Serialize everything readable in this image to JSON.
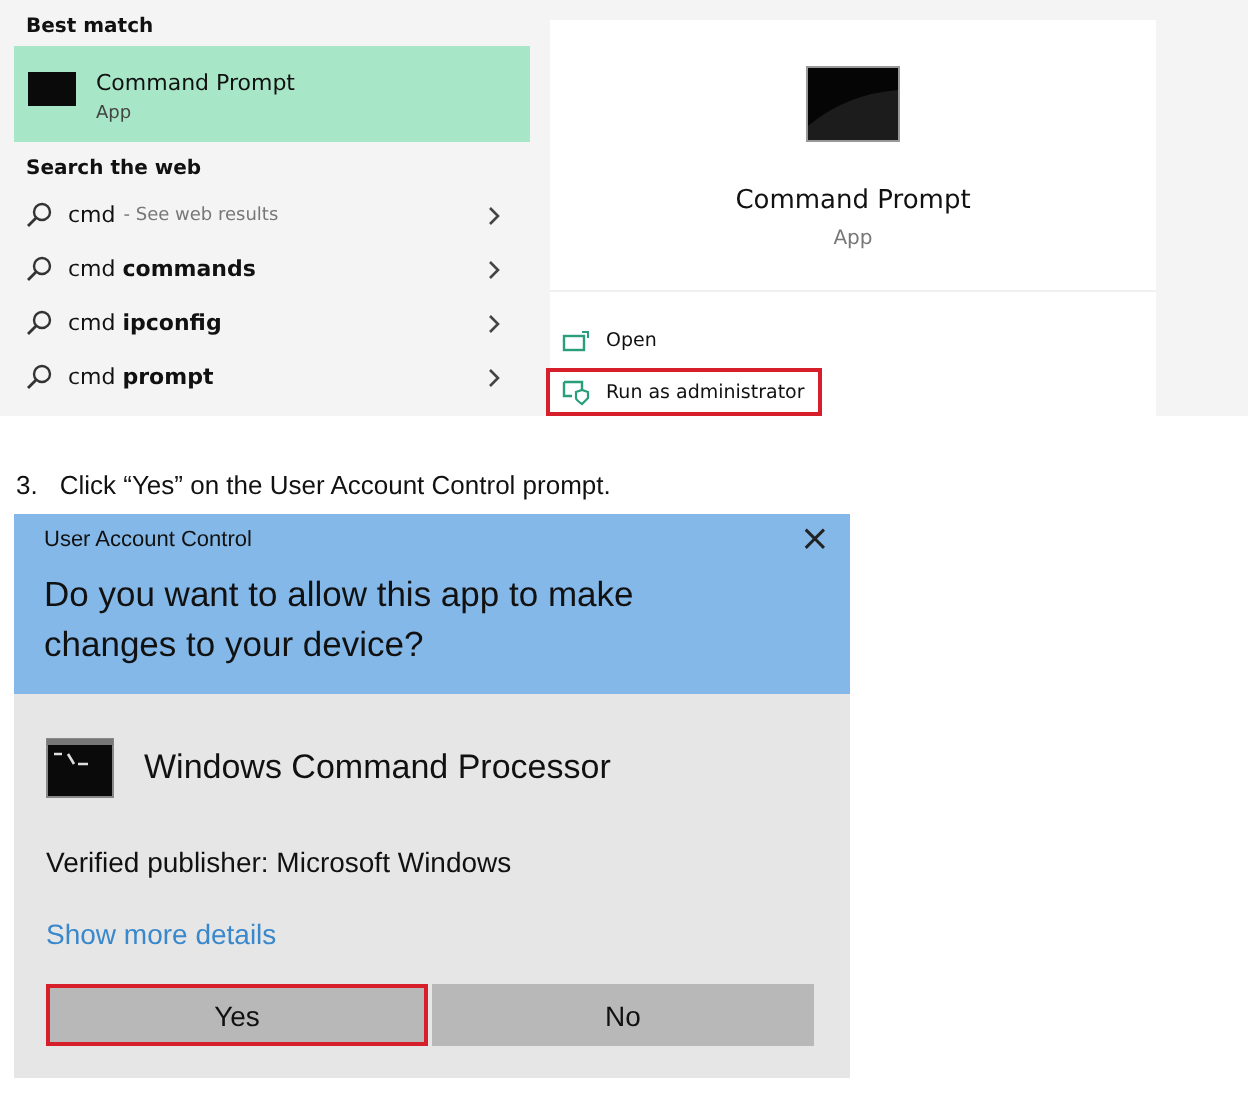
{
  "search_panel": {
    "best_match_heading": "Best match",
    "best_match": {
      "name": "Command Prompt",
      "type": "App",
      "selected": true
    },
    "web_heading": "Search the web",
    "web_results": [
      {
        "query": "cmd",
        "hint": "- See web results"
      },
      {
        "query": "cmd **commands**"
      },
      {
        "query": "cmd **ipconfig**"
      },
      {
        "query": "cmd **prompt**"
      }
    ],
    "preview": {
      "name": "Command Prompt",
      "type": "App",
      "actions": [
        {
          "kind": "open",
          "label": "Open",
          "highlighted": false
        },
        {
          "kind": "admin",
          "label": "Run as administrator",
          "highlighted": true
        }
      ]
    }
  },
  "step": {
    "number": "3.",
    "text": "Click “Yes” on the User Account Control prompt."
  },
  "dialog": {
    "title": "User Account Control",
    "close": "×",
    "question": "Do you want to allow this app to make changes to your device?",
    "program": "Windows Command Processor",
    "publisher": "Verified publisher: Microsoft Windows",
    "details_link": "Show more details",
    "buttons": [
      {
        "label": "Yes",
        "highlighted": true
      },
      {
        "label": "No",
        "highlighted": false
      }
    ]
  }
}
